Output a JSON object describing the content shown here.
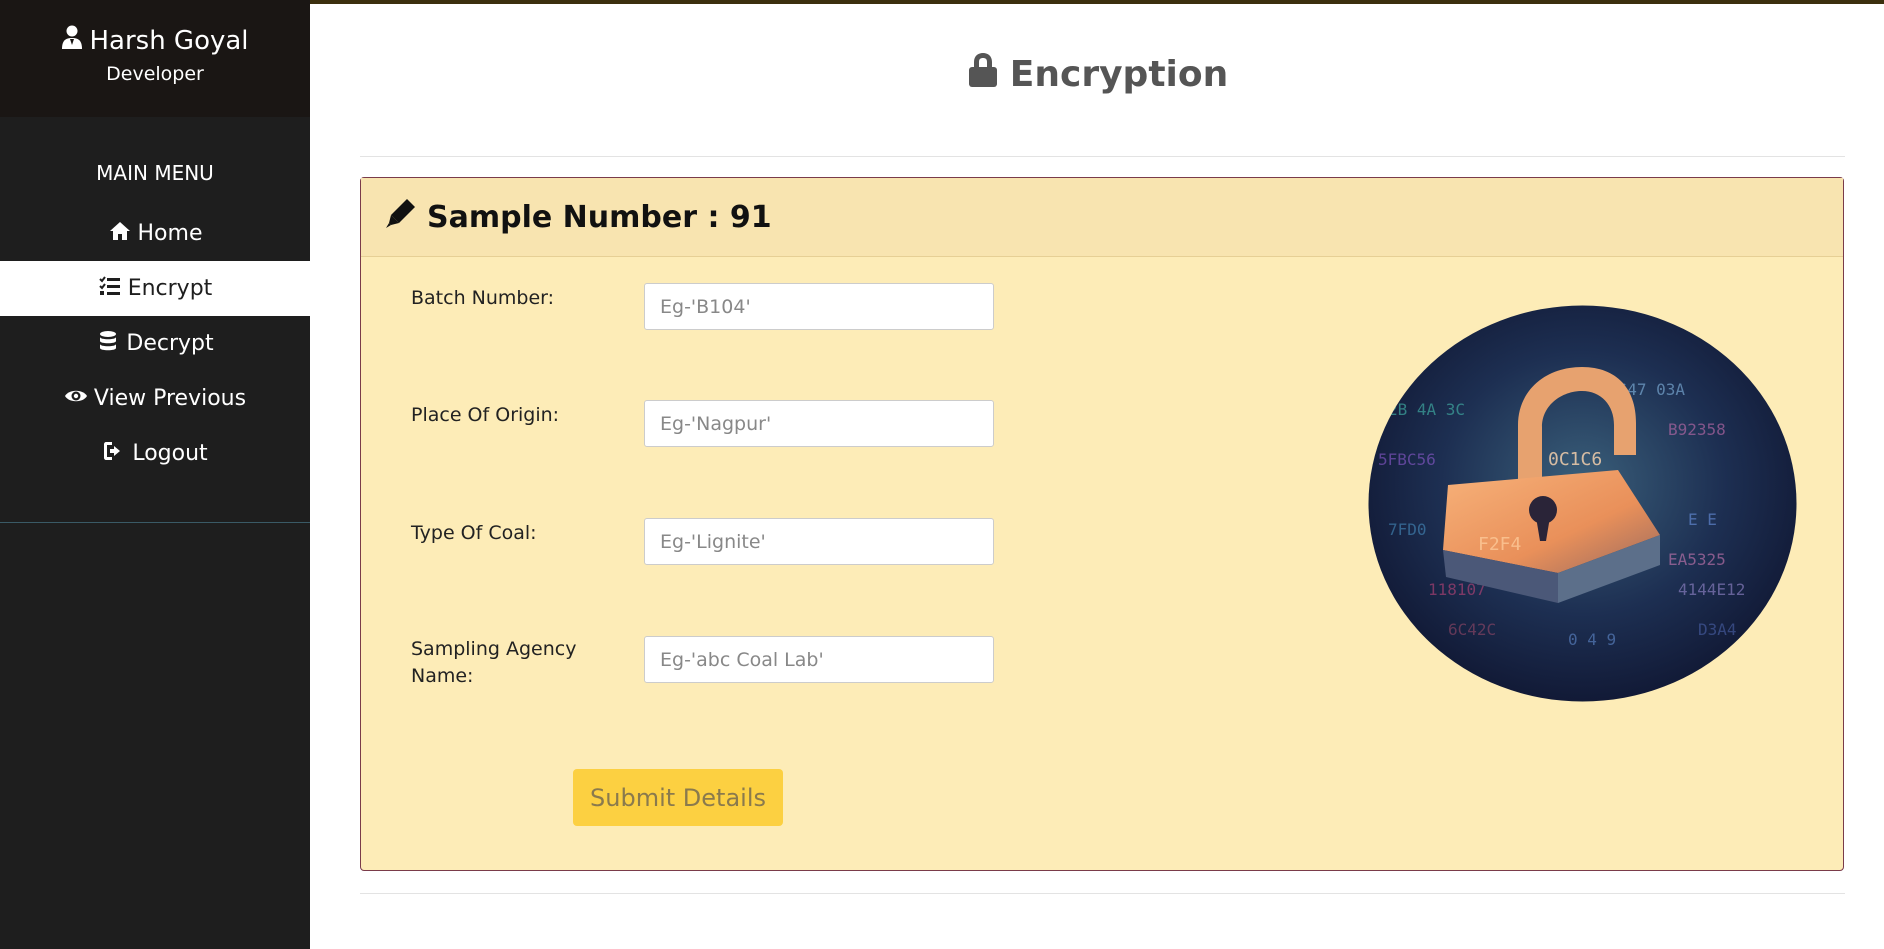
{
  "sidebar": {
    "profile": {
      "name": "Harsh Goyal",
      "role": "Developer"
    },
    "menu_title": "MAIN MENU",
    "items": [
      {
        "label": "Home",
        "icon": "home-icon",
        "active": false
      },
      {
        "label": "Encrypt",
        "icon": "list-check-icon",
        "active": true
      },
      {
        "label": "Decrypt",
        "icon": "database-icon",
        "active": false
      },
      {
        "label": "View Previous",
        "icon": "eye-icon",
        "active": false
      },
      {
        "label": "Logout",
        "icon": "sign-out-icon",
        "active": false
      }
    ]
  },
  "header": {
    "title": "Encryption",
    "icon": "lock-icon"
  },
  "card": {
    "title": "Sample Number : 91",
    "icon": "pen-icon",
    "fields": [
      {
        "label": "Batch Number:",
        "placeholder": "Eg-'B104'",
        "value": ""
      },
      {
        "label": "Place Of Origin:",
        "placeholder": "Eg-'Nagpur'",
        "value": ""
      },
      {
        "label": "Type Of Coal:",
        "placeholder": "Eg-'Lignite'",
        "value": ""
      },
      {
        "label": "Sampling Agency Name:",
        "placeholder": "Eg-'abc Coal Lab'",
        "value": ""
      }
    ],
    "submit_label": "Submit Details",
    "image": "padlock-digital-image"
  },
  "colors": {
    "sidebar_bg": "#1e1e1e",
    "profile_bg": "#1a1614",
    "card_bg": "#fdecb7",
    "card_header_bg": "#f8e4b0",
    "card_border": "#7a3b4a",
    "button_bg": "#fcd041",
    "title_color": "#555555"
  }
}
